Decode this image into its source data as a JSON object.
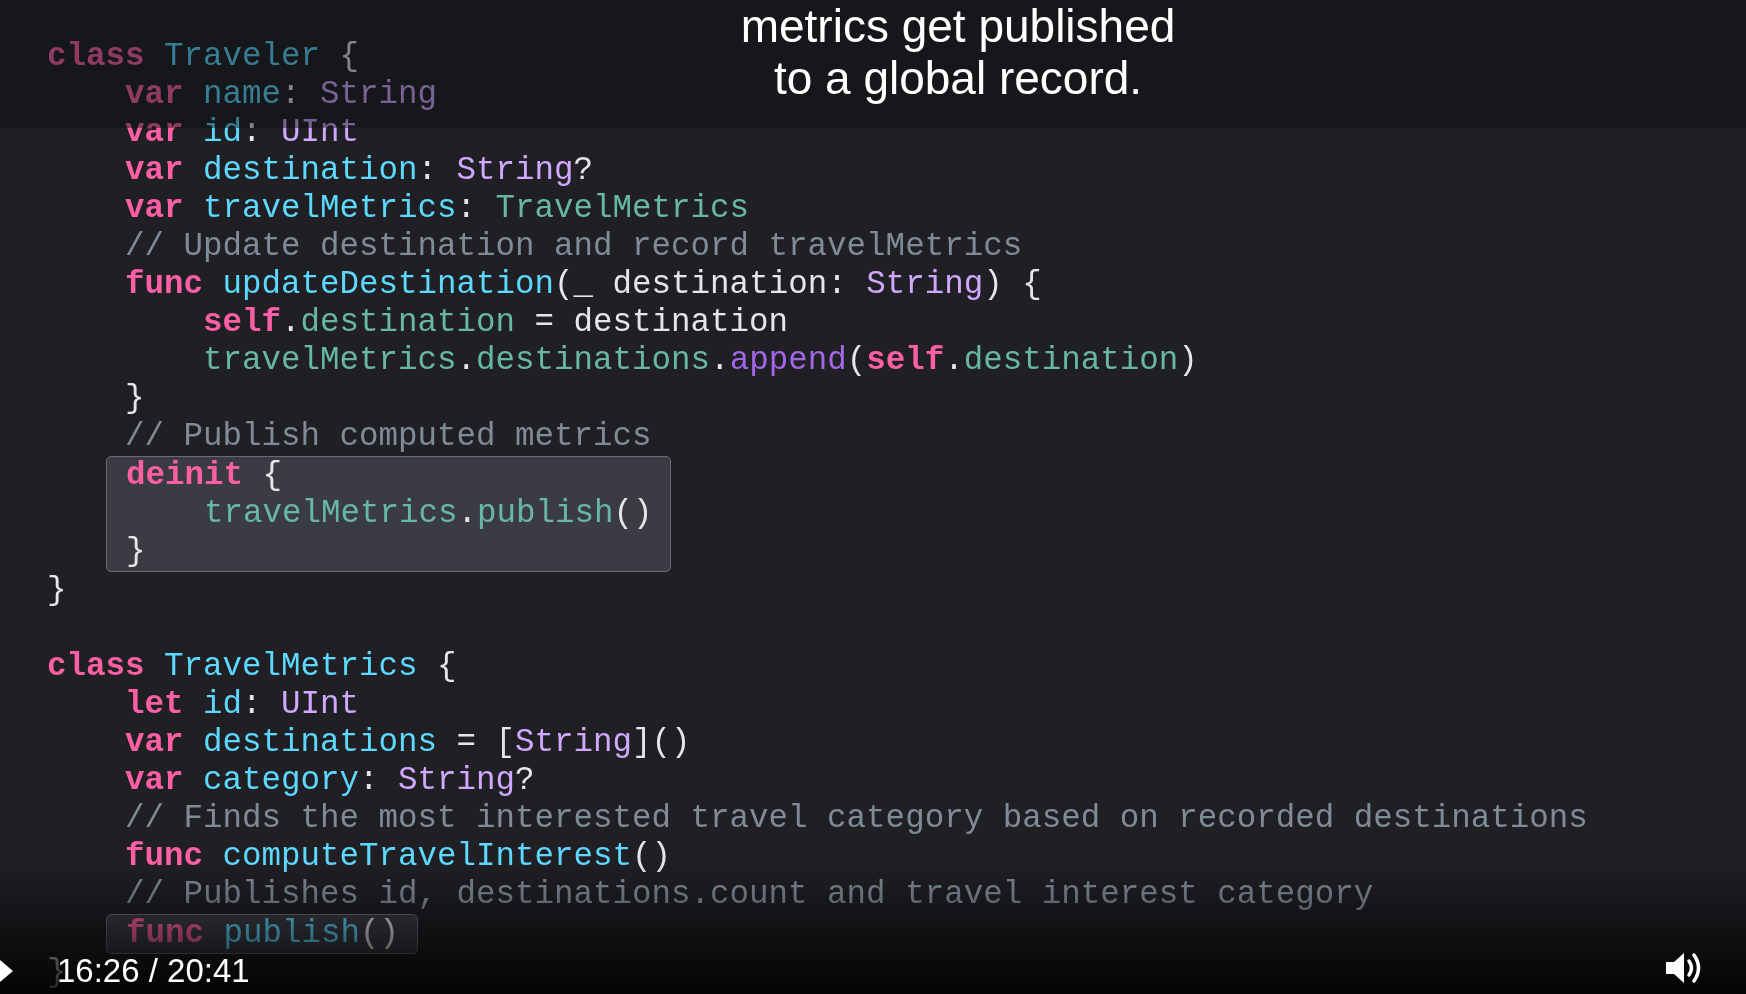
{
  "caption": {
    "lines": [
      "metrics get published",
      "to a global record."
    ]
  },
  "code": [
    {
      "highlighted": false,
      "tokens": [
        {
          "kind": "kw",
          "text": "class "
        },
        {
          "kind": "decl",
          "text": "Traveler"
        },
        {
          "kind": "plain",
          "text": " {"
        }
      ],
      "children": [
        {
          "highlighted": false,
          "tokens": [
            {
              "kind": "kw",
              "text": "var "
            },
            {
              "kind": "decl",
              "text": "name"
            },
            {
              "kind": "plain",
              "text": ": "
            },
            {
              "kind": "type",
              "text": "String"
            }
          ]
        },
        {
          "highlighted": false,
          "tokens": [
            {
              "kind": "kw",
              "text": "var "
            },
            {
              "kind": "decl",
              "text": "id"
            },
            {
              "kind": "plain",
              "text": ": "
            },
            {
              "kind": "type",
              "text": "UInt"
            }
          ]
        },
        {
          "highlighted": false,
          "tokens": [
            {
              "kind": "kw",
              "text": "var "
            },
            {
              "kind": "decl",
              "text": "destination"
            },
            {
              "kind": "plain",
              "text": ": "
            },
            {
              "kind": "type",
              "text": "String"
            },
            {
              "kind": "plain",
              "text": "?"
            }
          ]
        },
        {
          "highlighted": false,
          "tokens": [
            {
              "kind": "kw",
              "text": "var "
            },
            {
              "kind": "decl",
              "text": "travelMetrics"
            },
            {
              "kind": "plain",
              "text": ": "
            },
            {
              "kind": "proj",
              "text": "TravelMetrics"
            }
          ]
        },
        {
          "highlighted": false,
          "tokens": [
            {
              "kind": "comment",
              "text": "// Update destination and record travelMetrics"
            }
          ]
        },
        {
          "highlighted": false,
          "tokens": [
            {
              "kind": "kw",
              "text": "func "
            },
            {
              "kind": "decl",
              "text": "updateDestination"
            },
            {
              "kind": "plain",
              "text": "(_ destination: "
            },
            {
              "kind": "type",
              "text": "String"
            },
            {
              "kind": "plain",
              "text": ") {"
            }
          ],
          "children": [
            {
              "highlighted": false,
              "tokens": [
                {
                  "kind": "kw",
                  "text": "self"
                },
                {
                  "kind": "plain",
                  "text": "."
                },
                {
                  "kind": "proj",
                  "text": "destination"
                },
                {
                  "kind": "plain",
                  "text": " = destination"
                }
              ]
            },
            {
              "highlighted": false,
              "tokens": [
                {
                  "kind": "proj",
                  "text": "travelMetrics"
                },
                {
                  "kind": "plain",
                  "text": "."
                },
                {
                  "kind": "proj",
                  "text": "destinations"
                },
                {
                  "kind": "plain",
                  "text": "."
                },
                {
                  "kind": "sys",
                  "text": "append"
                },
                {
                  "kind": "plain",
                  "text": "("
                },
                {
                  "kind": "kw",
                  "text": "self"
                },
                {
                  "kind": "plain",
                  "text": "."
                },
                {
                  "kind": "proj",
                  "text": "destination"
                },
                {
                  "kind": "plain",
                  "text": ")"
                }
              ]
            }
          ],
          "close": [
            {
              "kind": "plain",
              "text": "}"
            }
          ]
        },
        {
          "highlighted": false,
          "tokens": [
            {
              "kind": "comment",
              "text": "// Publish computed metrics"
            }
          ]
        },
        {
          "highlighted": true,
          "tokens": [
            {
              "kind": "kw",
              "text": "deinit"
            },
            {
              "kind": "plain",
              "text": " {"
            }
          ],
          "children": [
            {
              "highlighted": false,
              "tokens": [
                {
                  "kind": "proj",
                  "text": "travelMetrics"
                },
                {
                  "kind": "plain",
                  "text": "."
                },
                {
                  "kind": "proj",
                  "text": "publish"
                },
                {
                  "kind": "plain",
                  "text": "()"
                }
              ]
            }
          ],
          "close": [
            {
              "kind": "plain",
              "text": "}"
            }
          ]
        }
      ],
      "close": [
        {
          "kind": "plain",
          "text": "}"
        }
      ]
    },
    {
      "highlighted": false,
      "tokens": [
        {
          "kind": "kw",
          "text": "class "
        },
        {
          "kind": "decl",
          "text": "TravelMetrics"
        },
        {
          "kind": "plain",
          "text": " {"
        }
      ],
      "children": [
        {
          "highlighted": false,
          "tokens": [
            {
              "kind": "kw",
              "text": "let "
            },
            {
              "kind": "decl",
              "text": "id"
            },
            {
              "kind": "plain",
              "text": ": "
            },
            {
              "kind": "type",
              "text": "UInt"
            }
          ]
        },
        {
          "highlighted": false,
          "tokens": [
            {
              "kind": "kw",
              "text": "var "
            },
            {
              "kind": "decl",
              "text": "destinations"
            },
            {
              "kind": "plain",
              "text": " = ["
            },
            {
              "kind": "type",
              "text": "String"
            },
            {
              "kind": "plain",
              "text": "]()"
            }
          ]
        },
        {
          "highlighted": false,
          "tokens": [
            {
              "kind": "kw",
              "text": "var "
            },
            {
              "kind": "decl",
              "text": "category"
            },
            {
              "kind": "plain",
              "text": ": "
            },
            {
              "kind": "type",
              "text": "String"
            },
            {
              "kind": "plain",
              "text": "?"
            }
          ]
        },
        {
          "highlighted": false,
          "tokens": [
            {
              "kind": "comment",
              "text": "// Finds the most interested travel category based on recorded destinations"
            }
          ]
        },
        {
          "highlighted": false,
          "tokens": [
            {
              "kind": "kw",
              "text": "func "
            },
            {
              "kind": "decl",
              "text": "computeTravelInterest"
            },
            {
              "kind": "plain",
              "text": "()"
            }
          ]
        },
        {
          "highlighted": false,
          "tokens": [
            {
              "kind": "comment",
              "text": "// Publishes id, destinations.count and travel interest category"
            }
          ]
        },
        {
          "highlighted": true,
          "tokens": [
            {
              "kind": "kw",
              "text": "func "
            },
            {
              "kind": "decl",
              "text": "publish"
            },
            {
              "kind": "plain",
              "text": "()"
            }
          ]
        }
      ],
      "close": [
        {
          "kind": "plain",
          "text": "}"
        }
      ]
    }
  ],
  "player": {
    "time": "16:26 / 20:41"
  }
}
